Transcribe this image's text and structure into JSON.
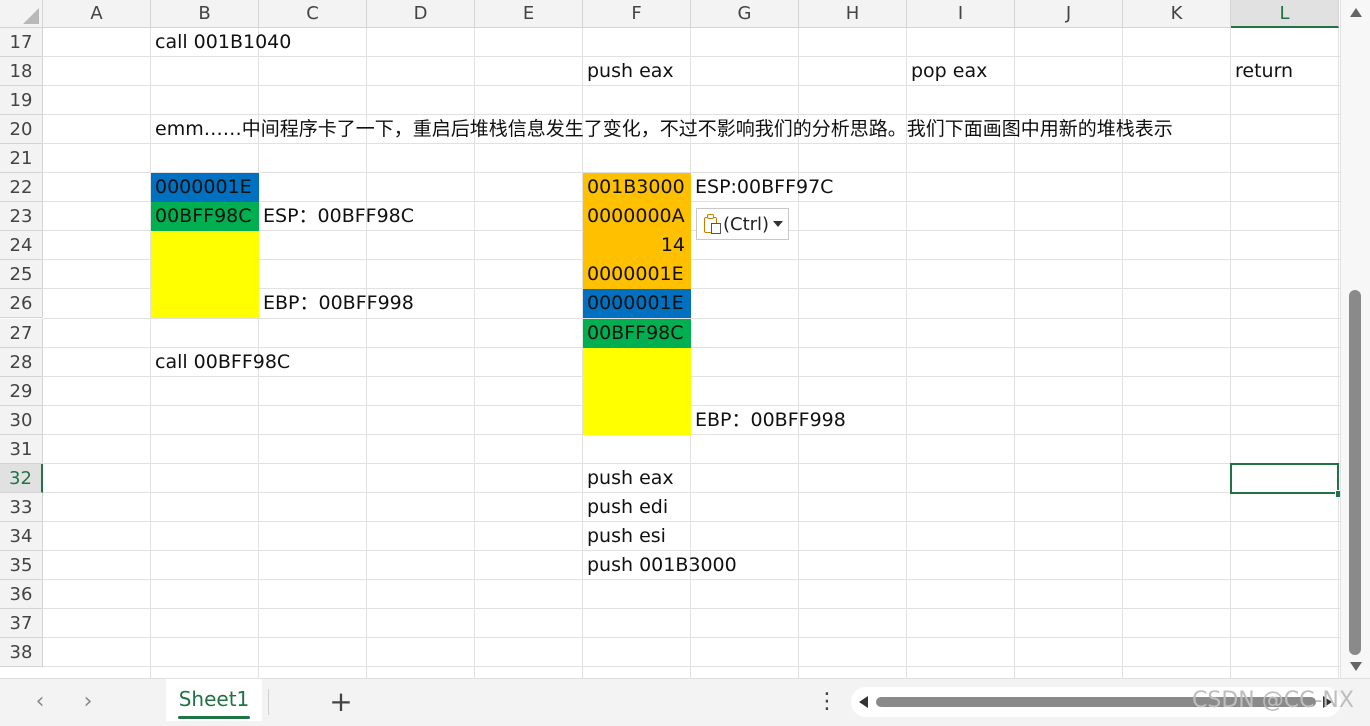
{
  "columns": [
    "A",
    "B",
    "C",
    "D",
    "E",
    "F",
    "G",
    "H",
    "I",
    "J",
    "K",
    "L"
  ],
  "rows": [
    "17",
    "18",
    "19",
    "20",
    "21",
    "22",
    "23",
    "24",
    "25",
    "26",
    "27",
    "28",
    "29",
    "30",
    "31",
    "32",
    "33",
    "34",
    "35",
    "36",
    "37",
    "38"
  ],
  "selected_column": "L",
  "selected_row": "32",
  "colors": {
    "blue": "#0070c0",
    "green": "#00b050",
    "yellow": "#ffff00",
    "orange": "#ffc000",
    "accent": "#217346"
  },
  "cells": {
    "B17": "call 001B1040",
    "F18": "push eax",
    "I18": "pop eax",
    "L18": "return",
    "B20": "emm……中间程序卡了一下，重启后堆栈信息发生了变化，不过不影响我们的分析思路。我们下面画图中用新的堆栈表示",
    "B22": "0000001E",
    "B23": "00BFF98C",
    "C23": "ESP：00BFF98C",
    "C26": "EBP：00BFF998",
    "B28": "call 00BFF98C",
    "F22": "001B3000",
    "G22": "ESP:00BFF97C",
    "F23": "0000000A",
    "F24": "14",
    "F25": "0000001E",
    "F26": "0000001E",
    "F27": "00BFF98C",
    "G30": "EBP：00BFF998",
    "F32": "push eax",
    "F33": "push edi",
    "F34": "push esi",
    "F35": "push 001B3000"
  },
  "paste_options": {
    "label": "(Ctrl)",
    "icon": "clipboard-icon"
  },
  "sheet_tabs": [
    {
      "label": "Sheet1",
      "active": true
    }
  ],
  "controls": {
    "add_sheet": "+",
    "more": "⋮",
    "prev_sheet": "‹",
    "next_sheet": "›"
  },
  "watermark": "CSDN @CC-NX"
}
